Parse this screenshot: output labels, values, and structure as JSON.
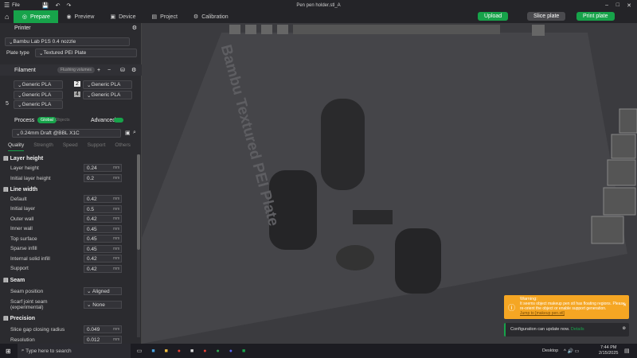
{
  "window": {
    "title": "Pen pen holder.stl_A",
    "menu": "File"
  },
  "tabs": [
    {
      "label": "Prepare"
    },
    {
      "label": "Preview"
    },
    {
      "label": "Device"
    },
    {
      "label": "Project"
    },
    {
      "label": "Calibration"
    }
  ],
  "actions": {
    "upload": "Upload",
    "slice": "Slice plate",
    "print": "Print plate"
  },
  "printer": {
    "title": "Printer",
    "model": "Bambu Lab P1S 0.4 nozzle",
    "plate_label": "Plate type",
    "plate": "Textured PEI Plate"
  },
  "filament": {
    "title": "Filament",
    "flushing": "Flushing volumes",
    "slots": [
      {
        "n": "1",
        "name": "Generic PLA"
      },
      {
        "n": "2",
        "name": "Generic PLA"
      },
      {
        "n": "3",
        "name": "Generic PLA"
      },
      {
        "n": "4",
        "name": "Generic PLA"
      },
      {
        "n": "5",
        "name": "Generic PLA"
      }
    ]
  },
  "process": {
    "title": "Process",
    "global": "Global",
    "objects": "Objects",
    "advanced": "Advanced",
    "preset": "0.24mm Draft @BBL X1C",
    "tabs": [
      "Quality",
      "Strength",
      "Speed",
      "Support",
      "Others"
    ]
  },
  "settings": {
    "layer_height": {
      "title": "Layer height",
      "rows": [
        {
          "label": "Layer height",
          "value": "0.24",
          "unit": "mm"
        },
        {
          "label": "Initial layer height",
          "value": "0.2",
          "unit": "mm"
        }
      ]
    },
    "line_width": {
      "title": "Line width",
      "rows": [
        {
          "label": "Default",
          "value": "0.42",
          "unit": "mm"
        },
        {
          "label": "Initial layer",
          "value": "0.5",
          "unit": "mm"
        },
        {
          "label": "Outer wall",
          "value": "0.42",
          "unit": "mm"
        },
        {
          "label": "Inner wall",
          "value": "0.45",
          "unit": "mm"
        },
        {
          "label": "Top surface",
          "value": "0.45",
          "unit": "mm"
        },
        {
          "label": "Sparse infill",
          "value": "0.45",
          "unit": "mm"
        },
        {
          "label": "Internal solid infill",
          "value": "0.42",
          "unit": "mm"
        },
        {
          "label": "Support",
          "value": "0.42",
          "unit": "mm"
        }
      ]
    },
    "seam": {
      "title": "Seam",
      "position_label": "Seam position",
      "position": "Aligned",
      "scarf_label": "Scarf joint seam (experimental)",
      "scarf": "None"
    },
    "precision": {
      "title": "Precision",
      "rows": [
        {
          "label": "Slice gap closing radius",
          "value": "0.049",
          "unit": "mm"
        },
        {
          "label": "Resolution",
          "value": "0.012",
          "unit": "mm"
        }
      ]
    }
  },
  "plate_text": "Bambu Textured PEI Plate",
  "warning": {
    "title": "Warning:",
    "body": "It seems object makeup pen stl has floating regions. Please re-orient the object or enable support generation.",
    "link": "Jump to [makeup pen.stl]"
  },
  "config_notice": {
    "text": "Configuration can update now.",
    "link": "Details"
  },
  "taskbar": {
    "search": "Type here to search",
    "desktop": "Desktop",
    "time": "7:44 PM",
    "date": "2/15/2025"
  }
}
